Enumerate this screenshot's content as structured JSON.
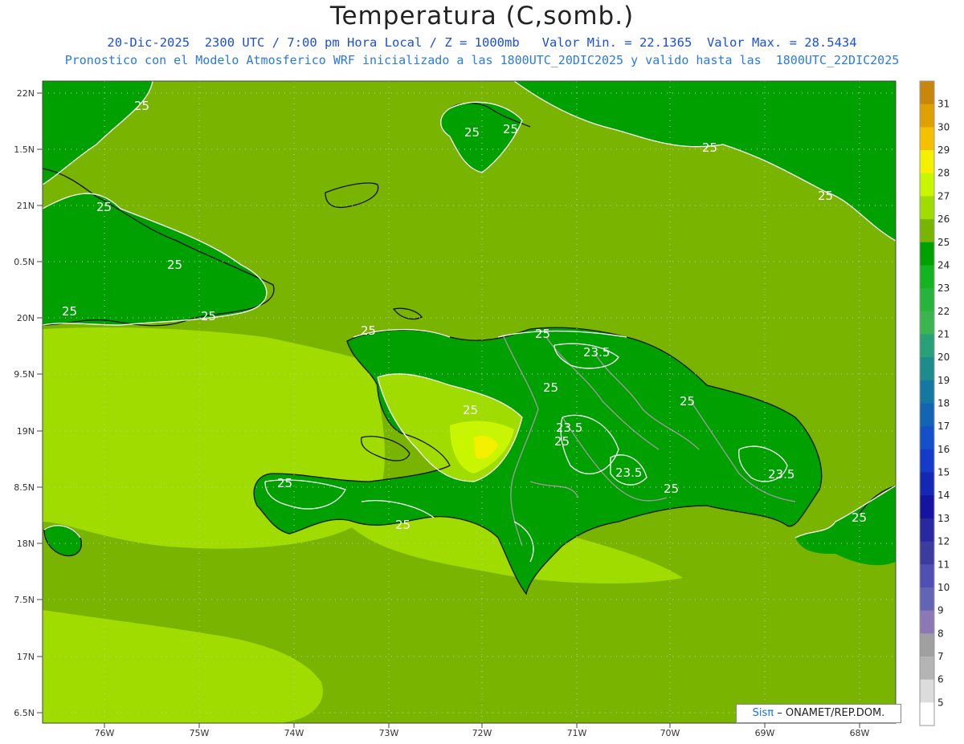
{
  "header": {
    "title": "Temperatura (C,somb.)",
    "subtitle1": "20-Dic-2025  2300 UTC / 7:00 pm Hora Local / Z = 1000mb   Valor Min. = 22.1365  Valor Max. = 28.5434",
    "subtitle2": "Pronostico con el Modelo Atmosferico WRF inicializado a las 1800UTC_20DIC2025 y valido hasta las  1800UTC_22DIC2025"
  },
  "credit": {
    "brand": "Sisπ",
    "text": "– ONAMET/REP.DOM."
  },
  "map": {
    "lat_labels": [
      "22N",
      "1.5N",
      "21N",
      "0.5N",
      "20N",
      "9.5N",
      "19N",
      "8.5N",
      "18N",
      "7.5N",
      "17N",
      "6.5N"
    ],
    "lon_labels": [
      "76W",
      "75W",
      "74W",
      "73W",
      "72W",
      "71W",
      "70W",
      "69W",
      "68W"
    ],
    "contour_labels": [
      "25",
      "25",
      "25",
      "25",
      "25",
      "25",
      "25",
      "25",
      "25",
      "25",
      "25",
      "25",
      "25",
      "25",
      "25",
      "25",
      "25",
      "23.5",
      "23.5",
      "23.5",
      "23.5",
      "25",
      "25"
    ]
  },
  "colorbar": {
    "ticks": [
      "31",
      "30",
      "29",
      "28",
      "27",
      "26",
      "25",
      "24",
      "23",
      "22",
      "21",
      "20",
      "19",
      "18",
      "17",
      "16",
      "15",
      "14",
      "13",
      "12",
      "11",
      "10",
      "9",
      "8",
      "7",
      "6",
      "5"
    ],
    "colors": [
      "#c8860a",
      "#e0a000",
      "#f5c000",
      "#f5f000",
      "#c8f500",
      "#a0dc00",
      "#78b400",
      "#00a000",
      "#14b41e",
      "#28b43c",
      "#3cb450",
      "#28a078",
      "#1e8c8c",
      "#1478a0",
      "#1464b4",
      "#1450c8",
      "#143cc8",
      "#1428b4",
      "#1414a0",
      "#2828a0",
      "#3c3ca0",
      "#5050b4",
      "#6464b4",
      "#8c78b4",
      "#a0a0a0",
      "#b4b4b4",
      "#dcdcdc",
      "#ffffff"
    ]
  }
}
